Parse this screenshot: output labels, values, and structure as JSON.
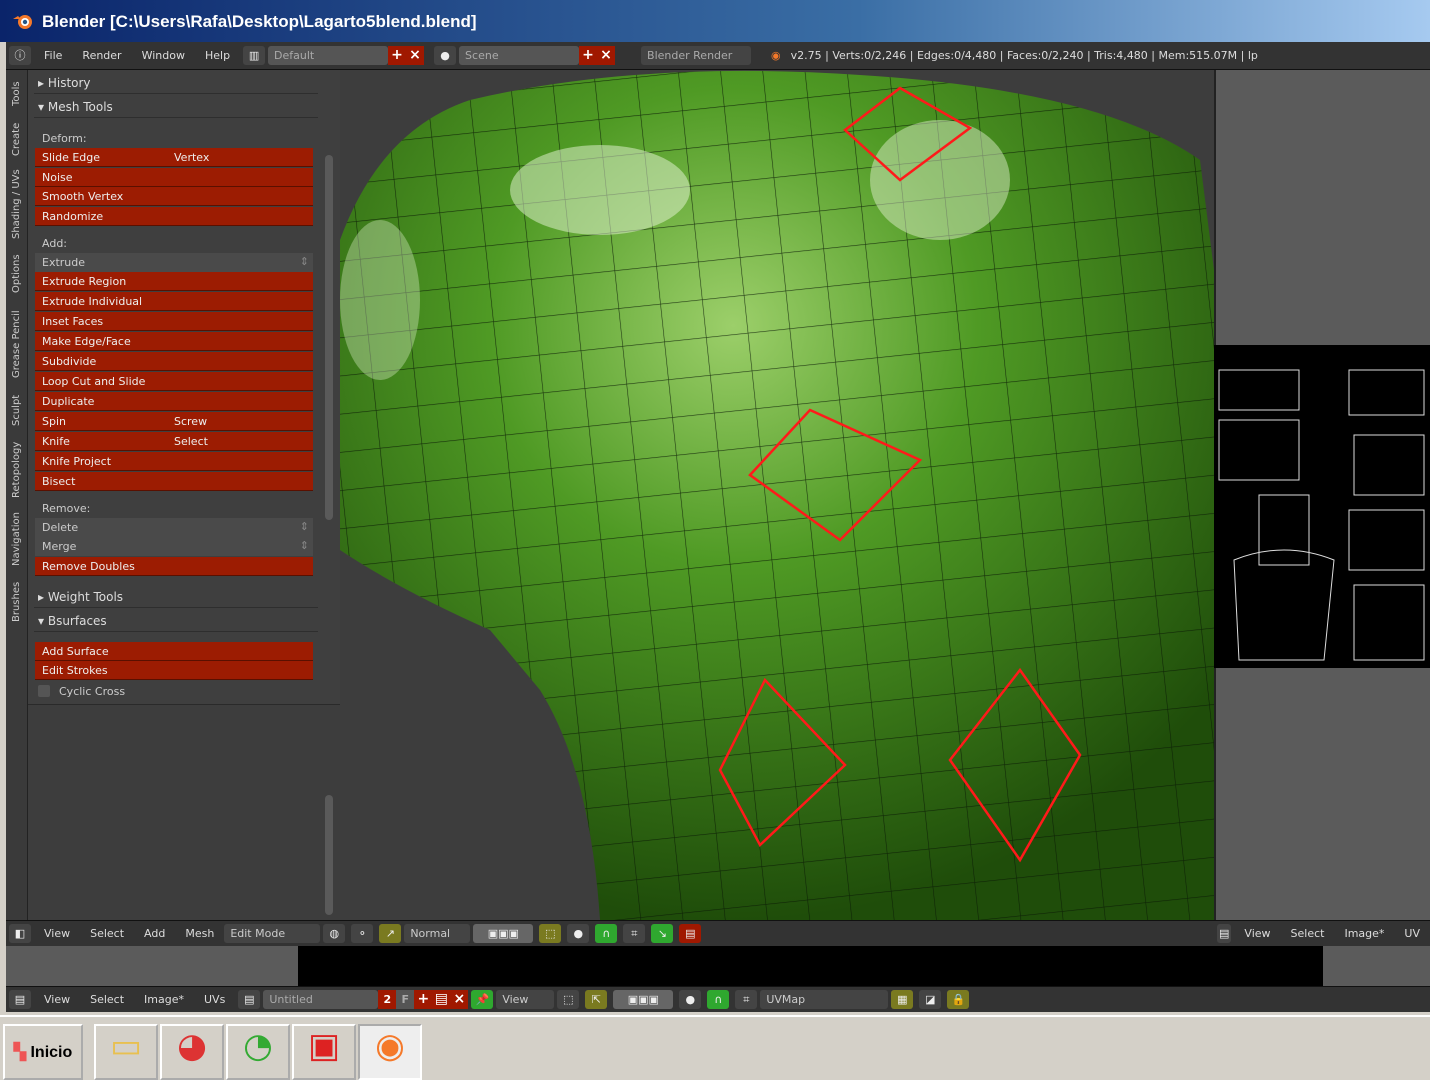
{
  "window": {
    "title": "Blender [C:\\Users\\Rafa\\Desktop\\Lagarto5blend.blend]"
  },
  "topbar": {
    "menus": [
      "File",
      "Render",
      "Window",
      "Help"
    ],
    "layout": "Default",
    "scene": "Scene",
    "engine": "Blender Render",
    "stats": "v2.75 | Verts:0/2,246 | Edges:0/4,480 | Faces:0/2,240 | Tris:4,480 | Mem:515.07M | lp"
  },
  "tabs": [
    "Tools",
    "Create",
    "Shading / UVs",
    "Options",
    "Grease Pencil",
    "Sculpt",
    "Retopology",
    "Navigation",
    "Brushes"
  ],
  "toolpanel": {
    "history": "History",
    "mesh_tools": "Mesh Tools",
    "deform_label": "Deform:",
    "slide_edge": "Slide Edge",
    "vertex": "Vertex",
    "noise": "Noise",
    "smooth_vertex": "Smooth Vertex",
    "randomize": "Randomize",
    "add_label": "Add:",
    "extrude": "Extrude",
    "extrude_region": "Extrude Region",
    "extrude_individual": "Extrude Individual",
    "inset_faces": "Inset Faces",
    "make_edge_face": "Make Edge/Face",
    "subdivide": "Subdivide",
    "loop_cut": "Loop Cut and Slide",
    "duplicate": "Duplicate",
    "spin": "Spin",
    "screw": "Screw",
    "knife": "Knife",
    "select": "Select",
    "knife_project": "Knife Project",
    "bisect": "Bisect",
    "remove_label": "Remove:",
    "delete": "Delete",
    "merge": "Merge",
    "remove_doubles": "Remove Doubles",
    "weight_tools": "Weight Tools",
    "bsurfaces": "Bsurfaces",
    "add_surface": "Add Surface",
    "edit_strokes": "Edit Strokes",
    "cyclic_cross": "Cyclic Cross"
  },
  "header3d": {
    "menus": [
      "View",
      "Select",
      "Add",
      "Mesh"
    ],
    "mode": "Edit Mode",
    "orientation": "Normal"
  },
  "headeruv_right": {
    "menus": [
      "View",
      "Select",
      "Image*",
      "UV"
    ]
  },
  "headeruv": {
    "menus": [
      "View",
      "Select",
      "Image*",
      "UVs"
    ],
    "image": "Untitled",
    "users": "2",
    "fake": "F",
    "view": "View",
    "uvmap": "UVMap"
  },
  "taskbar": {
    "start": "Inicio"
  },
  "colors": {
    "red_button": "#9c1c02",
    "mesh_green": "#3f8a1a",
    "annotation": "#ff1a1a"
  }
}
